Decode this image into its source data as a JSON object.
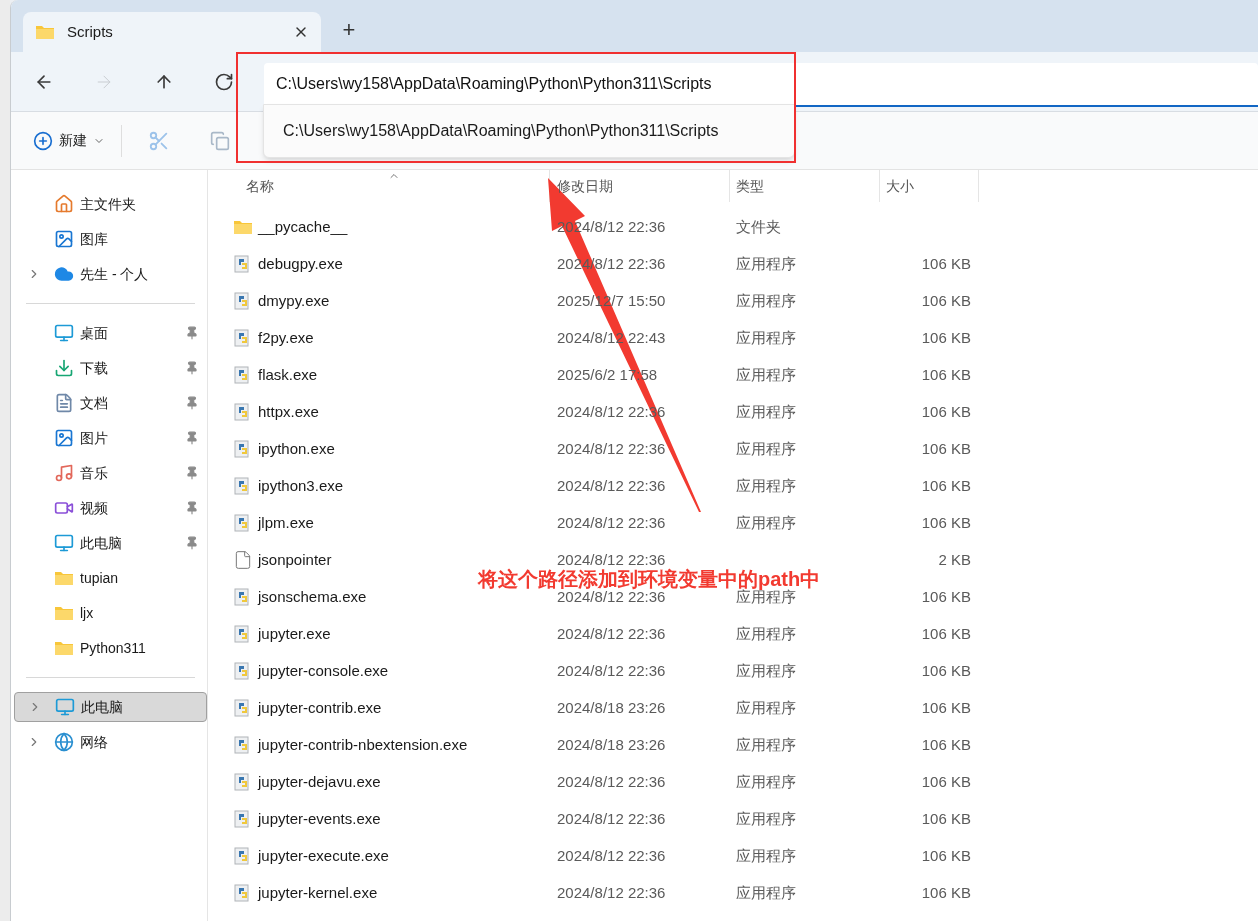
{
  "tabs": [
    {
      "title": "Scripts",
      "selected": true
    }
  ],
  "new_tab": "+",
  "nav_buttons": [
    {
      "kind": "back",
      "disabled": false
    },
    {
      "kind": "forward",
      "disabled": true
    },
    {
      "kind": "up",
      "disabled": false
    },
    {
      "kind": "refresh",
      "disabled": false
    }
  ],
  "address": {
    "value": "C:\\Users\\wy158\\AppData\\Roaming\\Python\\Python311\\Scripts",
    "suggestions": [
      "C:\\Users\\wy158\\AppData\\Roaming\\Python\\Python311\\Scripts"
    ]
  },
  "toolbar": {
    "new_label": "新建",
    "cut_disabled": true,
    "copy_disabled": true
  },
  "sidebar": {
    "groups": [
      [
        {
          "label": "主文件夹",
          "expandable": false,
          "pinned": false,
          "selected": false
        },
        {
          "label": "图库",
          "expandable": false,
          "pinned": false,
          "selected": false
        },
        {
          "label": "先生 - 个人",
          "expandable": true,
          "pinned": false,
          "selected": false
        }
      ],
      [
        {
          "label": "桌面",
          "expandable": false,
          "pinned": true,
          "selected": false
        },
        {
          "label": "下载",
          "expandable": false,
          "pinned": true,
          "selected": false
        },
        {
          "label": "文档",
          "expandable": false,
          "pinned": true,
          "selected": false
        },
        {
          "label": "图片",
          "expandable": false,
          "pinned": true,
          "selected": false
        },
        {
          "label": "音乐",
          "expandable": false,
          "pinned": true,
          "selected": false
        },
        {
          "label": "视频",
          "expandable": false,
          "pinned": true,
          "selected": false
        },
        {
          "label": "此电脑",
          "expandable": false,
          "pinned": true,
          "selected": false
        },
        {
          "label": "tupian",
          "expandable": false,
          "pinned": false,
          "selected": false
        },
        {
          "label": "ljx",
          "expandable": false,
          "pinned": false,
          "selected": false
        },
        {
          "label": "Python311",
          "expandable": false,
          "pinned": false,
          "selected": false
        }
      ],
      [
        {
          "label": "此电脑",
          "expandable": true,
          "pinned": false,
          "selected": true
        },
        {
          "label": "网络",
          "expandable": true,
          "pinned": false,
          "selected": false
        }
      ]
    ]
  },
  "table": {
    "columns": [
      "名称",
      "修改日期",
      "类型",
      "大小"
    ],
    "rows": [
      {
        "kind": "folder",
        "name": "__pycache__",
        "date": "2024/8/12 22:36",
        "type": "文件夹"
      },
      {
        "kind": "app",
        "name": "debugpy.exe",
        "date": "2024/8/12 22:36",
        "type": "应用程序",
        "size": "106 KB"
      },
      {
        "kind": "app",
        "name": "dmypy.exe",
        "date": "2025/12/7 15:50",
        "type": "应用程序",
        "size": "106 KB"
      },
      {
        "kind": "app",
        "name": "f2py.exe",
        "date": "2024/8/12 22:43",
        "type": "应用程序",
        "size": "106 KB"
      },
      {
        "kind": "app",
        "name": "flask.exe",
        "date": "2025/6/2 17:58",
        "type": "应用程序",
        "size": "106 KB"
      },
      {
        "kind": "app",
        "name": "httpx.exe",
        "date": "2024/8/12 22:36",
        "type": "应用程序",
        "size": "106 KB"
      },
      {
        "kind": "app",
        "name": "ipython.exe",
        "date": "2024/8/12 22:36",
        "type": "应用程序",
        "size": "106 KB"
      },
      {
        "kind": "app",
        "name": "ipython3.exe",
        "date": "2024/8/12 22:36",
        "type": "应用程序",
        "size": "106 KB"
      },
      {
        "kind": "app",
        "name": "jlpm.exe",
        "date": "2024/8/12 22:36",
        "type": "应用程序",
        "size": "106 KB"
      },
      {
        "kind": "file",
        "name": "jsonpointer",
        "date": "2024/8/12 22:36",
        "size": "2 KB"
      },
      {
        "kind": "app",
        "name": "jsonschema.exe",
        "date": "2024/8/12 22:36",
        "type": "应用程序",
        "size": "106 KB"
      },
      {
        "kind": "app",
        "name": "jupyter.exe",
        "date": "2024/8/12 22:36",
        "type": "应用程序",
        "size": "106 KB"
      },
      {
        "kind": "app",
        "name": "jupyter-console.exe",
        "date": "2024/8/12 22:36",
        "type": "应用程序",
        "size": "106 KB"
      },
      {
        "kind": "app",
        "name": "jupyter-contrib.exe",
        "date": "2024/8/18 23:26",
        "type": "应用程序",
        "size": "106 KB"
      },
      {
        "kind": "app",
        "name": "jupyter-contrib-nbextension.exe",
        "date": "2024/8/18 23:26",
        "type": "应用程序",
        "size": "106 KB"
      },
      {
        "kind": "app",
        "name": "jupyter-dejavu.exe",
        "date": "2024/8/12 22:36",
        "type": "应用程序",
        "size": "106 KB"
      },
      {
        "kind": "app",
        "name": "jupyter-events.exe",
        "date": "2024/8/12 22:36",
        "type": "应用程序",
        "size": "106 KB"
      },
      {
        "kind": "app",
        "name": "jupyter-execute.exe",
        "date": "2024/8/12 22:36",
        "type": "应用程序",
        "size": "106 KB"
      },
      {
        "kind": "app",
        "name": "jupyter-kernel.exe",
        "date": "2024/8/12 22:36",
        "type": "应用程序",
        "size": "106 KB"
      }
    ]
  },
  "annotation": {
    "text": "将这个路径添加到环境变量中的path中"
  }
}
